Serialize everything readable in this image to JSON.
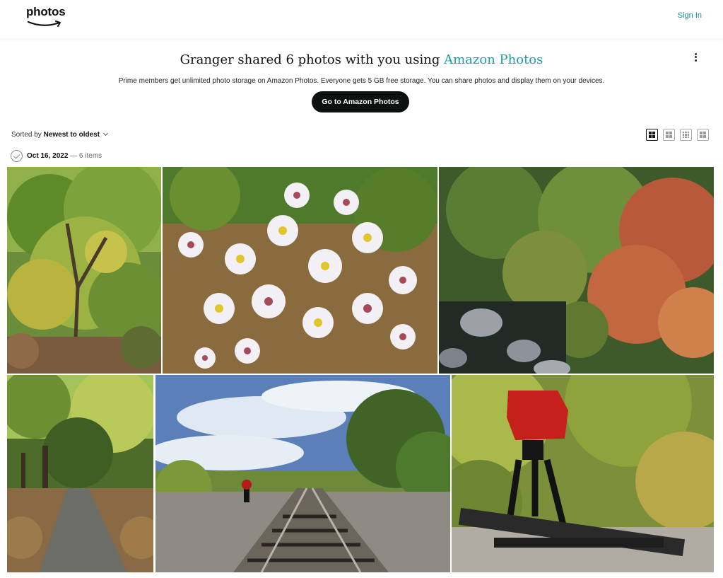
{
  "header": {
    "logo_text": "photos",
    "signin_label": "Sign In"
  },
  "hero": {
    "title_prefix": "Granger shared 6 photos with you using ",
    "title_brand": "Amazon Photos",
    "subtitle": "Prime members get unlimited photo storage on Amazon Photos. Everyone gets 5 GB free storage. You can share photos and display them on your devices.",
    "cta_label": "Go to Amazon Photos"
  },
  "sort": {
    "prefix": "Sorted by ",
    "value": "Newest to oldest"
  },
  "group": {
    "date": "Oct 16, 2022",
    "meta": " — 6 items"
  },
  "colors": {
    "accent": "#1a9ea4",
    "cta_bg": "#0f1111"
  },
  "photos": [
    {
      "subject": "green tree with autumn leaves"
    },
    {
      "subject": "white aster flowers"
    },
    {
      "subject": "autumn vines over rocks and water"
    },
    {
      "subject": "tree-lined leaf-covered path"
    },
    {
      "subject": "railroad tracks under blue sky"
    },
    {
      "subject": "red railroad switch stand"
    }
  ]
}
